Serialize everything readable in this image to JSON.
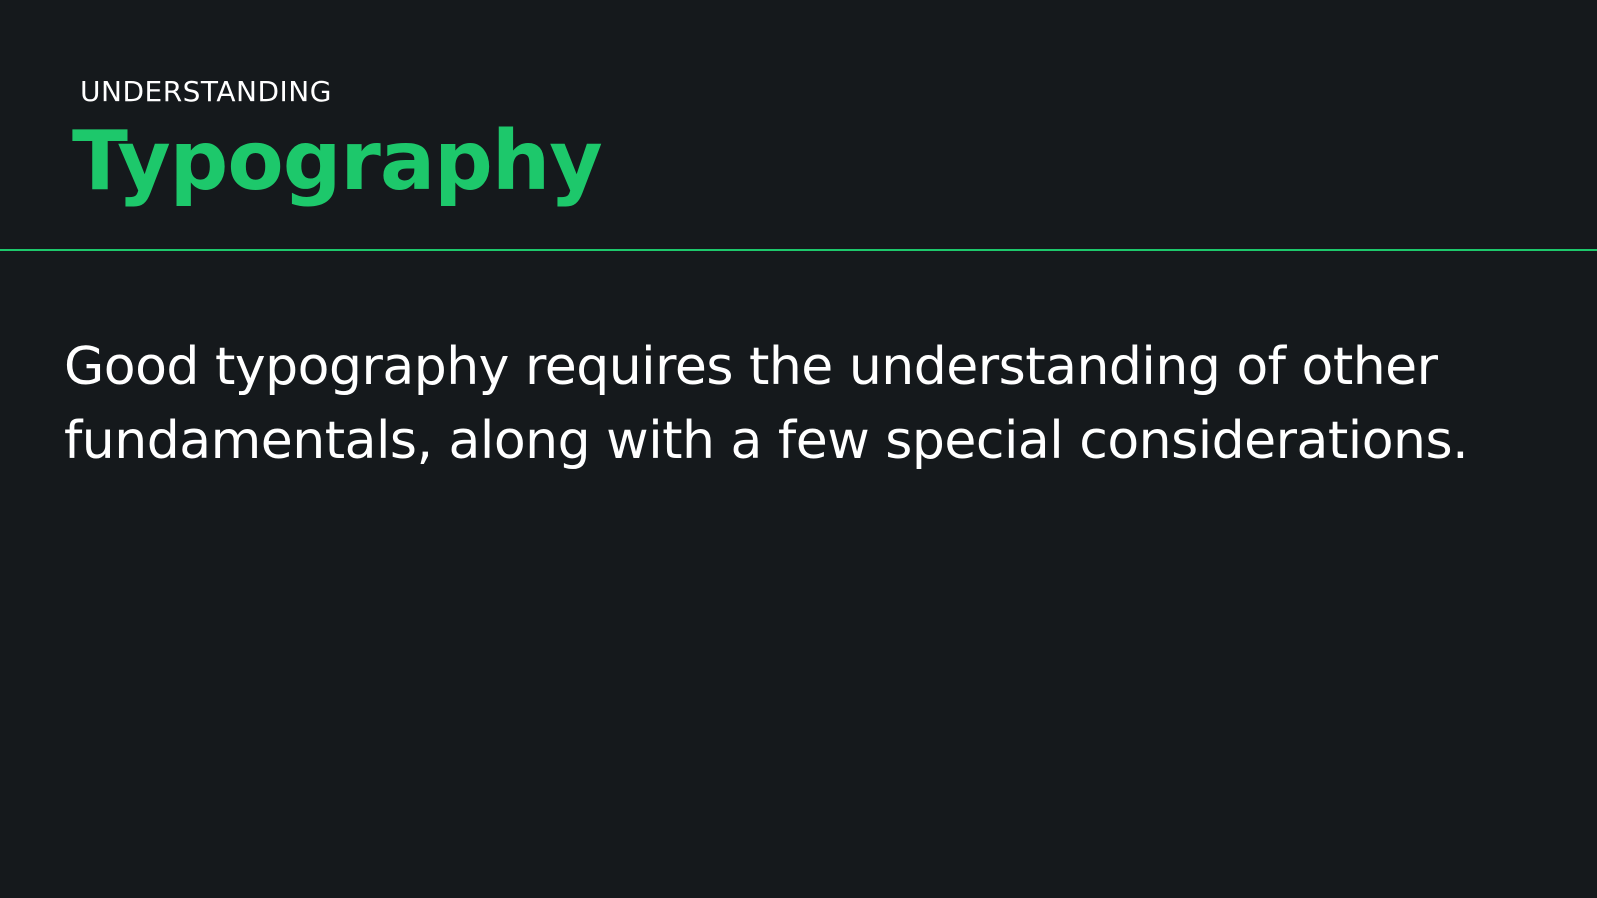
{
  "slide": {
    "eyebrow": "UNDERSTANDING",
    "title": "Typography",
    "body": "Good typography requires the understanding of other fundamentals, along with a few special considerations."
  },
  "colors": {
    "background": "#15191c",
    "accent": "#1dc86b",
    "text": "#ffffff"
  }
}
